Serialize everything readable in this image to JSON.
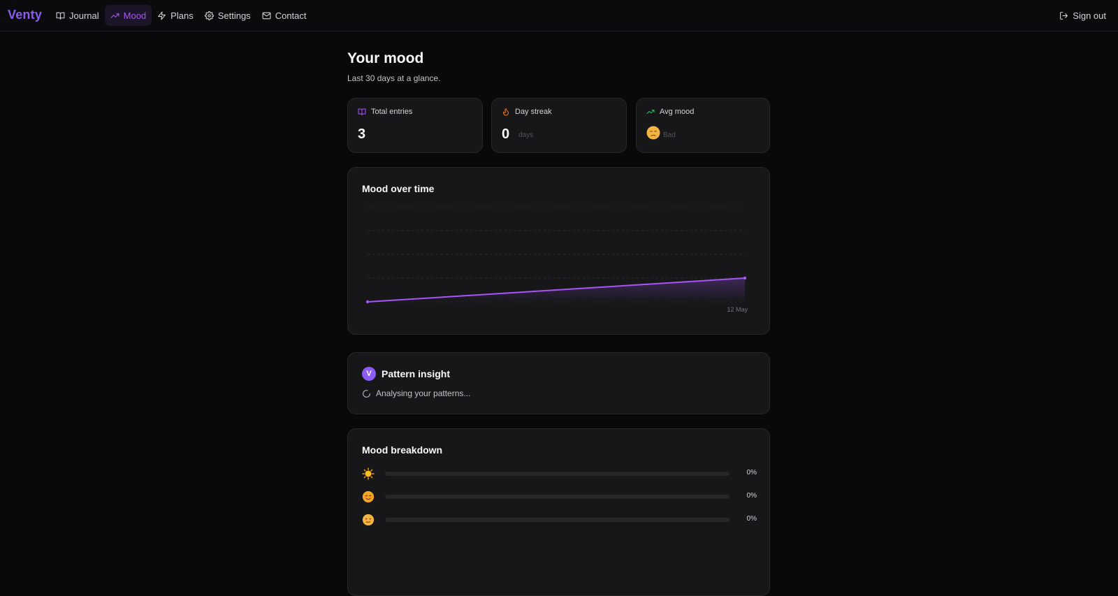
{
  "app": {
    "brand": "Venty",
    "accent": "#8b5cf6"
  },
  "nav": {
    "items": [
      {
        "label": "Journal",
        "icon": "book-icon",
        "active": false
      },
      {
        "label": "Mood",
        "icon": "trending-up-icon",
        "active": true
      },
      {
        "label": "Plans",
        "icon": "bolt-icon",
        "active": false
      },
      {
        "label": "Settings",
        "icon": "gear-icon",
        "active": false
      },
      {
        "label": "Contact",
        "icon": "mail-icon",
        "active": false
      }
    ],
    "signout_label": "Sign out"
  },
  "page": {
    "title": "Your mood",
    "subtitle": "Last 30 days at a glance."
  },
  "stats": {
    "total_entries": {
      "label": "Total entries",
      "value": "3",
      "icon": "book-icon",
      "color": "#a855f7"
    },
    "day_streak": {
      "label": "Day streak",
      "value": "0",
      "unit": "days",
      "icon": "flame-icon",
      "color": "#f97316"
    },
    "avg_mood": {
      "label": "Avg mood",
      "value": "Bad",
      "icon": "trending-up-icon",
      "color": "#22c55e",
      "emoji": "sad-face-icon"
    }
  },
  "chart": {
    "title": "Mood over time",
    "chart_data": {
      "type": "area",
      "x_tick_labels": [
        "12 May"
      ],
      "series": [
        {
          "values": [
            1,
            2
          ]
        }
      ],
      "ylim": [
        1,
        5
      ],
      "grid": true,
      "color": "#a855f7"
    }
  },
  "insight": {
    "badge": "V",
    "title": "Pattern insight",
    "status": "Analysing your patterns..."
  },
  "breakdown": {
    "title": "Mood breakdown",
    "rows": [
      {
        "emoji": "sun-icon",
        "percent": "0%",
        "fraction": 0
      },
      {
        "emoji": "smiling-face-icon",
        "percent": "0%",
        "fraction": 0
      },
      {
        "emoji": "neutral-face-icon",
        "percent": "0%",
        "fraction": 0
      }
    ]
  }
}
